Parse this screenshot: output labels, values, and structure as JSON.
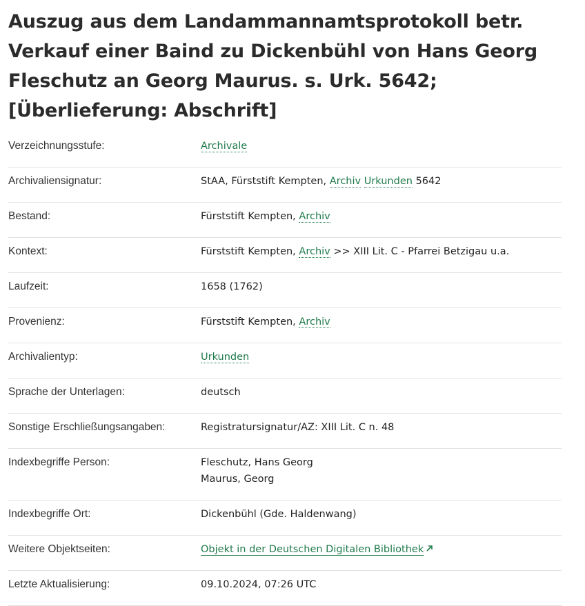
{
  "title": "Auszug aus dem Landammannamtsprotokoll betr. Verkauf einer Baind zu Dickenbühl von Hans Georg Fleschutz an Georg Maurus. s. Urk. 5642; [Überlieferung: Abschrift]",
  "rows": {
    "stufe": {
      "label": "Verzeichnungsstufe:",
      "link": "Archivale"
    },
    "signatur": {
      "label": "Archivaliensignatur:",
      "prefix": "StAA, Fürststift Kempten,",
      "link1": "Archiv",
      "link2": "Urkunden",
      "suffix": "5642"
    },
    "bestand": {
      "label": "Bestand:",
      "prefix": "Fürststift Kempten,",
      "link": "Archiv"
    },
    "kontext": {
      "label": "Kontext:",
      "prefix": "Fürststift Kempten,",
      "link": "Archiv",
      "suffix": ">> XIII Lit. C - Pfarrei Betzigau u.a."
    },
    "laufzeit": {
      "label": "Laufzeit:",
      "value": "1658 (1762)"
    },
    "provenienz": {
      "label": "Provenienz:",
      "prefix": "Fürststift Kempten,",
      "link": "Archiv"
    },
    "typ": {
      "label": "Archivalientyp:",
      "link": "Urkunden"
    },
    "sprache": {
      "label": "Sprache der Unterlagen:",
      "value": "deutsch"
    },
    "sonstige": {
      "label": "Sonstige Erschließungsangaben:",
      "value": "Registratursignatur/AZ: XIII Lit. C n. 48"
    },
    "person": {
      "label": "Indexbegriffe Person:",
      "values": [
        "Fleschutz, Hans Georg",
        "Maurus, Georg"
      ]
    },
    "ort": {
      "label": "Indexbegriffe Ort:",
      "value": "Dickenbühl (Gde. Haldenwang)"
    },
    "objekt": {
      "label": "Weitere Objektseiten:",
      "link": "Objekt in der Deutschen Digitalen Bibliothek",
      "icon": "external-link-icon"
    },
    "aktualisierung": {
      "label": "Letzte Aktualisierung:",
      "value": "09.10.2024, 07:26 UTC"
    }
  },
  "colors": {
    "link": "#1f7a4a",
    "divider": "#e2e2e2",
    "text": "#222222"
  }
}
